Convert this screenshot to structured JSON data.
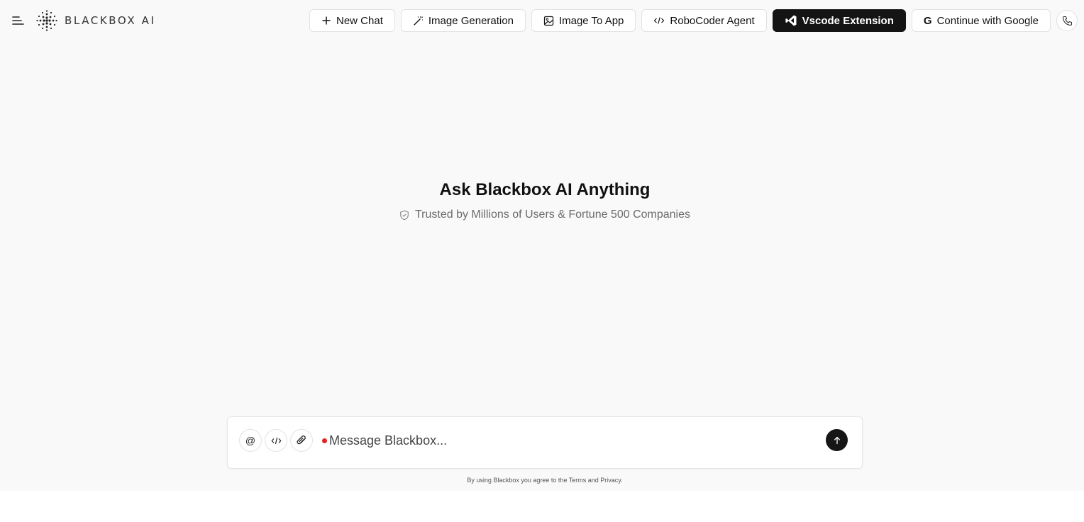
{
  "header": {
    "logo_text": "BLACKBOX AI",
    "nav": [
      {
        "label": "New Chat",
        "icon": "plus-icon"
      },
      {
        "label": "Image Generation",
        "icon": "magic-wand-icon"
      },
      {
        "label": "Image To App",
        "icon": "image-icon"
      },
      {
        "label": "RoboCoder Agent",
        "icon": "code-icon"
      },
      {
        "label": "Vscode Extension",
        "icon": "vscode-icon"
      },
      {
        "label": "Continue with Google",
        "icon": "google-icon"
      }
    ],
    "phone_icon": "phone-icon",
    "menu_icon": "menu-icon"
  },
  "hero": {
    "title": "Ask Blackbox AI Anything",
    "subtitle": "Trusted by Millions of Users & Fortune 500 Companies",
    "subtitle_icon": "shield-check-icon"
  },
  "composer": {
    "mention_label": "@",
    "placeholder": "Message Blackbox...",
    "value": "",
    "tools": [
      "at-icon",
      "code-icon",
      "paperclip-icon"
    ],
    "send_icon": "arrow-up-icon"
  },
  "footer": {
    "legal": "By using Blackbox you agree to the Terms and Privacy."
  },
  "colors": {
    "background": "#f9f9f9",
    "primary_dark": "#141414",
    "status_dot": "#e02424",
    "muted_text": "#6b6b6b"
  }
}
